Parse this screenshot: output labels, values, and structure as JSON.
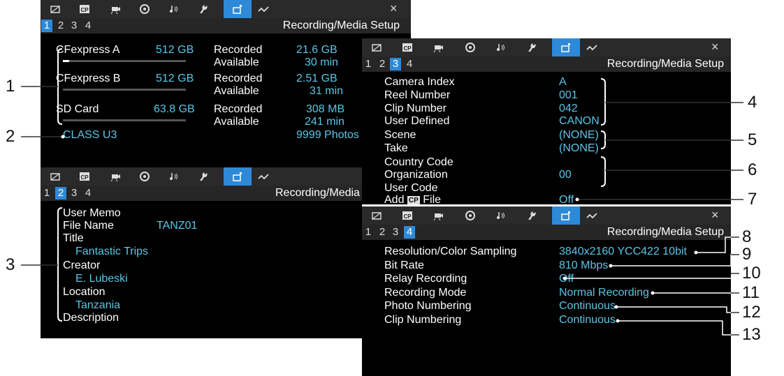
{
  "tab_icons": [
    "camera-icon",
    "cp-icon",
    "movie-icon",
    "color-icon",
    "audio-icon",
    "wrench-icon",
    "media-setup-icon",
    "network-icon"
  ],
  "close_glyph": "×",
  "panel1": {
    "pages": [
      "1",
      "2",
      "3",
      "4"
    ],
    "active_page": "1",
    "title": "Recording/Media Setup",
    "media": [
      {
        "name": "CFexpress A",
        "capacity": "512 GB",
        "recorded_label": "Recorded",
        "recorded": "21.6 GB",
        "available_label": "Available",
        "available": "30 min",
        "used_fraction": 0.05
      },
      {
        "name": "CFexpress B",
        "capacity": "512 GB",
        "recorded_label": "Recorded",
        "recorded": "2.51 GB",
        "available_label": "Available",
        "available": "31 min",
        "used_fraction": 0.0
      },
      {
        "name": "SD Card",
        "capacity": "63.8 GB",
        "recorded_label": "Recorded",
        "recorded": "308 MB",
        "available_label": "Available",
        "available": "241 min",
        "used_fraction": 0.0
      }
    ],
    "class_label": "CLASS U3",
    "photos": "9999 Photos"
  },
  "panel2": {
    "pages": [
      "1",
      "2",
      "3",
      "4"
    ],
    "active_page": "2",
    "title": "Recording/Media Setup",
    "user_memo": "User Memo",
    "file_name_label": "File Name",
    "file_name": "TANZ01",
    "title_label": "Title",
    "title_value": "Fantastic Trips",
    "creator_label": "Creator",
    "creator_value": "E. Lubeski",
    "location_label": "Location",
    "location_value": "Tanzania",
    "description_label": "Description"
  },
  "panel3": {
    "pages": [
      "1",
      "2",
      "3",
      "4"
    ],
    "active_page": "3",
    "title": "Recording/Media Setup",
    "rows": [
      {
        "label": "Camera Index",
        "value": "A"
      },
      {
        "label": "Reel Number",
        "value": "001"
      },
      {
        "label": "Clip Number",
        "value": "042"
      },
      {
        "label": "User Defined",
        "value": "CANON"
      },
      {
        "label": "Scene",
        "value": "(NONE)"
      },
      {
        "label": "Take",
        "value": "(NONE)"
      },
      {
        "label": "Country Code",
        "value": ""
      },
      {
        "label": "Organization",
        "value": "00"
      },
      {
        "label": "User Code",
        "value": ""
      }
    ],
    "add_label_pre": "Add",
    "add_label_icon": "CP",
    "add_label_post": "File",
    "add_value": "Off"
  },
  "panel4": {
    "pages": [
      "1",
      "2",
      "3",
      "4"
    ],
    "active_page": "4",
    "title": "Recording/Media Setup",
    "rows": [
      {
        "label": "Resolution/Color Sampling",
        "value": "3840x2160 YCC422 10bit"
      },
      {
        "label": "Bit Rate",
        "value": "810 Mbps"
      },
      {
        "label": "Relay Recording",
        "value": "Off"
      },
      {
        "label": "Recording Mode",
        "value": "Normal Recording"
      },
      {
        "label": "Photo Numbering",
        "value": "Continuous"
      },
      {
        "label": "Clip Numbering",
        "value": "Continuous"
      }
    ]
  },
  "callouts": [
    "1",
    "2",
    "3",
    "4",
    "5",
    "6",
    "7",
    "8",
    "9",
    "10",
    "11",
    "12",
    "13"
  ]
}
